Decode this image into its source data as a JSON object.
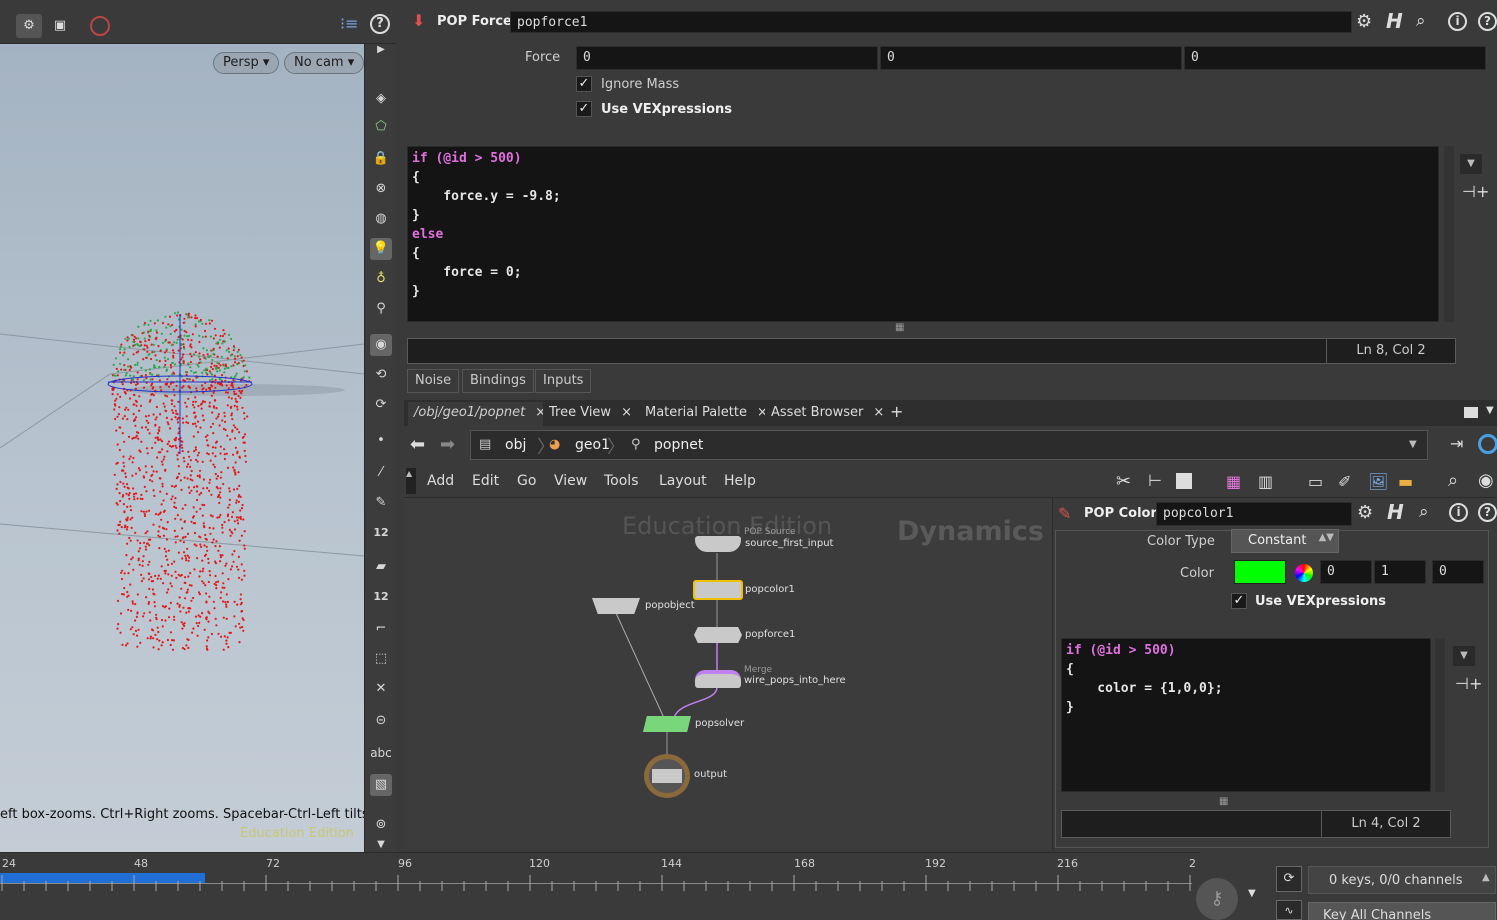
{
  "viewport": {
    "persp_label": "Persp",
    "cam_label": "No cam",
    "hint_text": "eft box-zooms. Ctrl+Right zooms. Spacebar-Ctrl-Left tilts.",
    "watermark": "Education Edition",
    "shelf_text_12a": "12",
    "shelf_text_12b": "12",
    "shelf_text_abc": "abc"
  },
  "param_panel": {
    "node_type": "POP Force",
    "node_name": "popforce1",
    "force_label": "Force",
    "force_values": [
      "0",
      "0",
      "0"
    ],
    "ignore_mass_label": "Ignore Mass",
    "ignore_mass_checked": "✓",
    "use_vex_label": "Use VEXpressions",
    "use_vex_checked": "✓",
    "code_lines": [
      "if (@id > 500)",
      "{",
      "    force.y = -9.8;",
      "}",
      "else",
      "{",
      "    force = 0;",
      "}"
    ],
    "cursor_pos": "Ln 8, Col 2",
    "tabs": [
      "Noise",
      "Bindings",
      "Inputs"
    ]
  },
  "network": {
    "tabs": [
      {
        "label": "/obj/geo1/popnet",
        "close": "×"
      },
      {
        "label": "Tree View",
        "close": "×"
      },
      {
        "label": "Material Palette",
        "close": "×"
      },
      {
        "label": "Asset Browser",
        "close": "×"
      }
    ],
    "add_tab": "+",
    "path": [
      "obj",
      "geo1",
      "popnet"
    ],
    "menu": [
      "Add",
      "Edit",
      "Go",
      "View",
      "Tools",
      "Layout",
      "Help"
    ],
    "watermark": "Education Edition",
    "context": "Dynamics",
    "nodes": {
      "source_type": "POP Source",
      "source_name": "source_first_input",
      "popcolor": "popcolor1",
      "popobject": "popobject",
      "popforce": "popforce1",
      "merge_type": "Merge",
      "merge_name": "wire_pops_into_here",
      "popsolver": "popsolver",
      "output": "output"
    }
  },
  "pop_color": {
    "node_type": "POP Color",
    "node_name": "popcolor1",
    "color_type_label": "Color Type",
    "color_type_value": "Constant",
    "color_label": "Color",
    "color_swatch": "#00ff00",
    "color_values": [
      "0",
      "1",
      "0"
    ],
    "use_vex_label": "Use VEXpressions",
    "use_vex_checked": "✓",
    "code_lines": [
      "if (@id > 500)",
      "{",
      "    color = {1,0,0};",
      "}"
    ],
    "cursor_pos": "Ln 4, Col 2"
  },
  "timeline": {
    "ticks": [
      "24",
      "48",
      "72",
      "96",
      "120",
      "144",
      "168",
      "192",
      "216",
      "2"
    ],
    "keys_status": "0 keys, 0/0 channels",
    "key_all": "Key All Channels"
  },
  "colors": {
    "accent_blue": "#1f6fd6",
    "selected_node": "#f0c000",
    "solver_green": "#7ad67a",
    "vex_keyword": "#e070e0"
  }
}
